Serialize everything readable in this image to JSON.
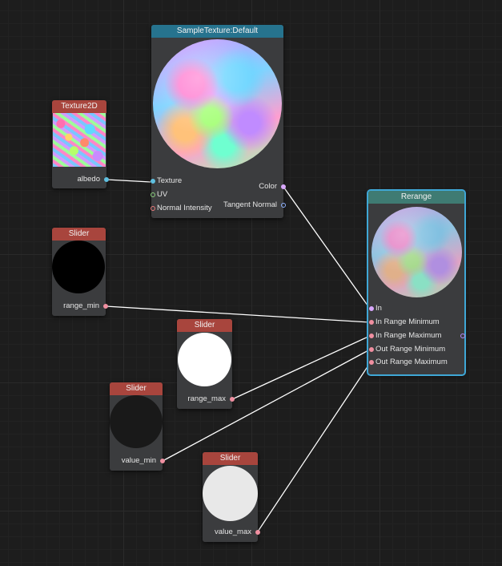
{
  "nodes": {
    "sample_texture": {
      "title": "SampleTexture:Default",
      "inputs": [
        "Texture",
        "UV",
        "Normal Intensity"
      ],
      "outputs": [
        "Color",
        "Tangent Normal"
      ]
    },
    "texture2d": {
      "title": "Texture2D",
      "output": "albedo"
    },
    "slider_range_min": {
      "title": "Slider",
      "output": "range_min"
    },
    "slider_range_max": {
      "title": "Slider",
      "output": "range_max"
    },
    "slider_value_min": {
      "title": "Slider",
      "output": "value_min"
    },
    "slider_value_max": {
      "title": "Slider",
      "output": "value_max"
    },
    "rerange": {
      "title": "Rerange",
      "inputs": [
        "In",
        "In Range Minimum",
        "In Range Maximum",
        "Out Range Minimum",
        "Out Range Maximum"
      ]
    }
  },
  "colors": {
    "header_slider": "#a8453d",
    "header_sample_texture": "#26738e",
    "header_rerange": "#3f7b73",
    "selection": "#3fa7d6",
    "wire": "#ffffff"
  }
}
